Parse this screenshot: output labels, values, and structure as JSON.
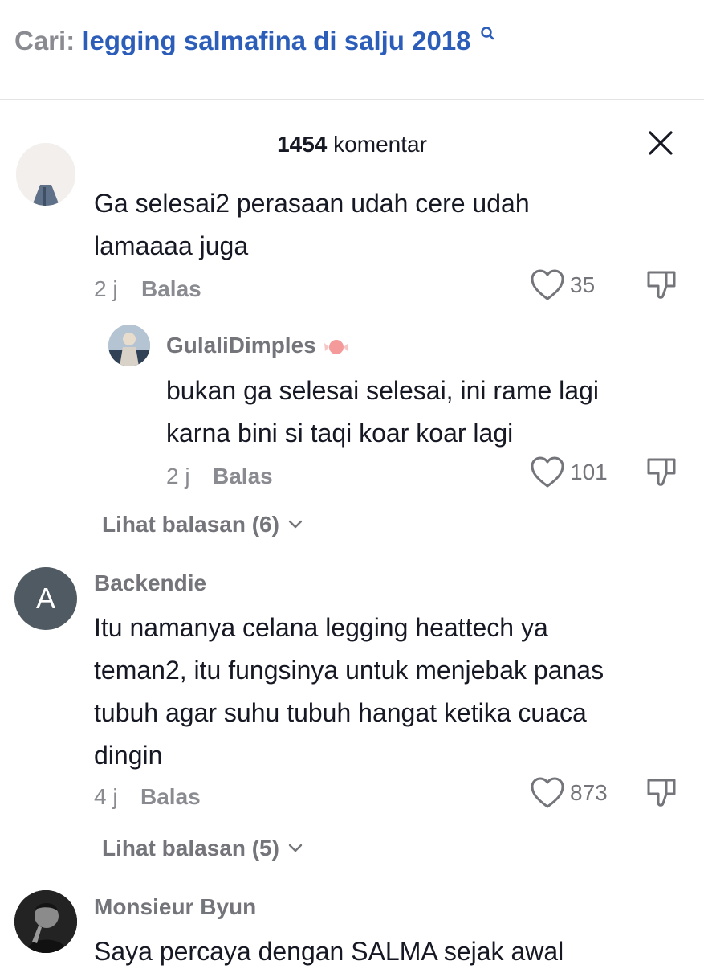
{
  "search": {
    "prefix": "Cari:",
    "query": "legging salmafina di salju 2018",
    "icon": "search-icon"
  },
  "header": {
    "count": "1454",
    "label": "komentar",
    "close_icon": "close-icon"
  },
  "comments": [
    {
      "text_lines": [
        "Ga selesai2 perasaan udah cere udah",
        "lamaaaa juga"
      ],
      "time": "2 j",
      "reply_label": "Balas",
      "likes": "35"
    },
    {
      "username": "GulaliDimples",
      "text_lines": [
        "bukan ga selesai selesai, ini rame lagi",
        "karna bini si taqi koar koar lagi"
      ],
      "time": "2 j",
      "reply_label": "Balas",
      "likes": "101"
    },
    {
      "username": "Backendie",
      "avatar_initial": "A",
      "text_lines": [
        "Itu namanya celana legging heattech ya",
        "teman2, itu fungsinya untuk menjebak panas",
        "tubuh agar suhu tubuh hangat ketika cuaca",
        "dingin"
      ],
      "time": "4 j",
      "reply_label": "Balas",
      "likes": "873"
    },
    {
      "username": "Monsieur Byun",
      "text_lines": [
        "Saya percaya dengan SALMA sejak awal"
      ]
    }
  ],
  "view_replies": [
    "Lihat balasan (6)",
    "Lihat balasan (5)"
  ],
  "colors": {
    "link_blue": "#2b5db9",
    "text_primary": "#161823",
    "text_secondary": "#8a8b91",
    "avatar_gray": "#4f5a62"
  }
}
